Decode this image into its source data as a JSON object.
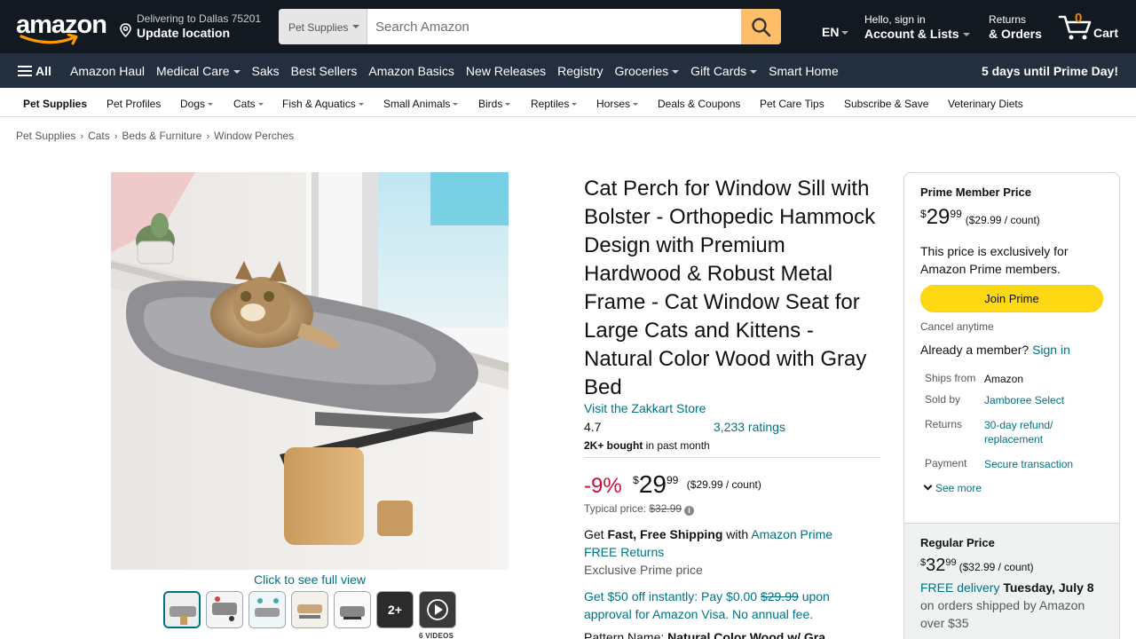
{
  "header": {
    "logo_text": "amazon",
    "deliver_line1": "Delivering to Dallas 75201",
    "deliver_line2": "Update location",
    "search_category": "Pet Supplies",
    "search_placeholder": "Search Amazon",
    "language": "EN",
    "account_line1": "Hello, sign in",
    "account_line2": "Account & Lists",
    "returns_line1": "Returns",
    "returns_line2": "& Orders",
    "cart_count": "0",
    "cart_label": "Cart"
  },
  "main_nav": {
    "all_label": "All",
    "items": [
      {
        "label": "Amazon Haul",
        "dropdown": false
      },
      {
        "label": "Medical Care",
        "dropdown": true
      },
      {
        "label": "Saks",
        "dropdown": false
      },
      {
        "label": "Best Sellers",
        "dropdown": false
      },
      {
        "label": "Amazon Basics",
        "dropdown": false
      },
      {
        "label": "New Releases",
        "dropdown": false
      },
      {
        "label": "Registry",
        "dropdown": false
      },
      {
        "label": "Groceries",
        "dropdown": true
      },
      {
        "label": "Gift Cards",
        "dropdown": true
      },
      {
        "label": "Smart Home",
        "dropdown": false
      }
    ],
    "promo": "5 days until Prime Day!"
  },
  "sub_nav": {
    "items": [
      {
        "label": "Pet Supplies",
        "bold": true,
        "dropdown": false
      },
      {
        "label": "Pet Profiles",
        "dropdown": false
      },
      {
        "label": "Dogs",
        "dropdown": true
      },
      {
        "label": "Cats",
        "dropdown": true
      },
      {
        "label": "Fish & Aquatics",
        "dropdown": true
      },
      {
        "label": "Small Animals",
        "dropdown": true
      },
      {
        "label": "Birds",
        "dropdown": true
      },
      {
        "label": "Reptiles",
        "dropdown": true
      },
      {
        "label": "Horses",
        "dropdown": true
      },
      {
        "label": "Deals & Coupons",
        "dropdown": false
      },
      {
        "label": "Pet Care Tips",
        "dropdown": false
      },
      {
        "label": "Subscribe & Save",
        "dropdown": false
      },
      {
        "label": "Veterinary Diets",
        "dropdown": false
      }
    ]
  },
  "breadcrumb": [
    "Pet Supplies",
    "Cats",
    "Beds & Furniture",
    "Window Perches"
  ],
  "gallery": {
    "full_view_label": "Click to see full view",
    "more_label": "2+",
    "videos_label": "6 VIDEOS"
  },
  "product": {
    "title": "Cat Perch for Window Sill with Bolster - Orthopedic Hammock Design with Premium Hardwood & Robust Metal Frame - Cat Window Seat for Large Cats and Kittens - Natural Color Wood with Gray Bed",
    "store_link": "Visit the Zakkart Store",
    "rating": "4.7",
    "ratings_count": "3,233 ratings",
    "bought_bold": "2K+ bought",
    "bought_rest": " in past month",
    "discount": "-9%",
    "price_symbol": "$",
    "price_whole": "29",
    "price_fraction": "99",
    "price_unit": "($29.99 / count)",
    "typical_label": "Typical price: ",
    "typical_price": "$32.99",
    "shipping_get": "Get ",
    "shipping_bold": "Fast, Free Shipping",
    "shipping_with": " with ",
    "shipping_prime_link": "Amazon Prime",
    "free_returns": "FREE Returns",
    "exclusive": "Exclusive Prime price",
    "visa_line_a": "Get $50 off instantly: Pay $0.00 ",
    "visa_strike": "$29.99",
    "visa_line_b": " upon approval for Amazon Visa. No annual fee.",
    "pattern_label": "Pattern Name: ",
    "pattern_value": "Natural Color Wood w/ Gra..."
  },
  "buybox": {
    "prime_title": "Prime Member Price",
    "prime_symbol": "$",
    "prime_whole": "29",
    "prime_fraction": "99",
    "prime_unit": "($29.99 / count)",
    "prime_desc": "This price is exclusively for Amazon Prime members.",
    "join_button": "Join Prime",
    "cancel": "Cancel anytime",
    "already_text": "Already a member? ",
    "sign_in": "Sign in",
    "details": [
      {
        "key": "Ships from",
        "value": "Amazon",
        "link": false
      },
      {
        "key": "Sold by",
        "value": "Jamboree Select",
        "link": true
      },
      {
        "key": "Returns",
        "value": "30-day refund/ replacement",
        "link": true
      },
      {
        "key": "Payment",
        "value": "Secure transaction",
        "link": true
      }
    ],
    "see_more": "See more",
    "regular_title": "Regular Price",
    "regular_symbol": "$",
    "regular_whole": "32",
    "regular_fraction": "99",
    "regular_unit": "($32.99 / count)",
    "free_delivery": "FREE delivery",
    "delivery_date": " Tuesday, July 8",
    "delivery_rest": " on orders shipped by Amazon over $35"
  },
  "colors": {
    "nav_dark": "#131921",
    "nav_secondary": "#232f3e",
    "search_button": "#febd69",
    "link": "#007185",
    "deal_red": "#cc0c39",
    "join_yellow": "#ffd814",
    "cart_orange": "#f08804"
  }
}
